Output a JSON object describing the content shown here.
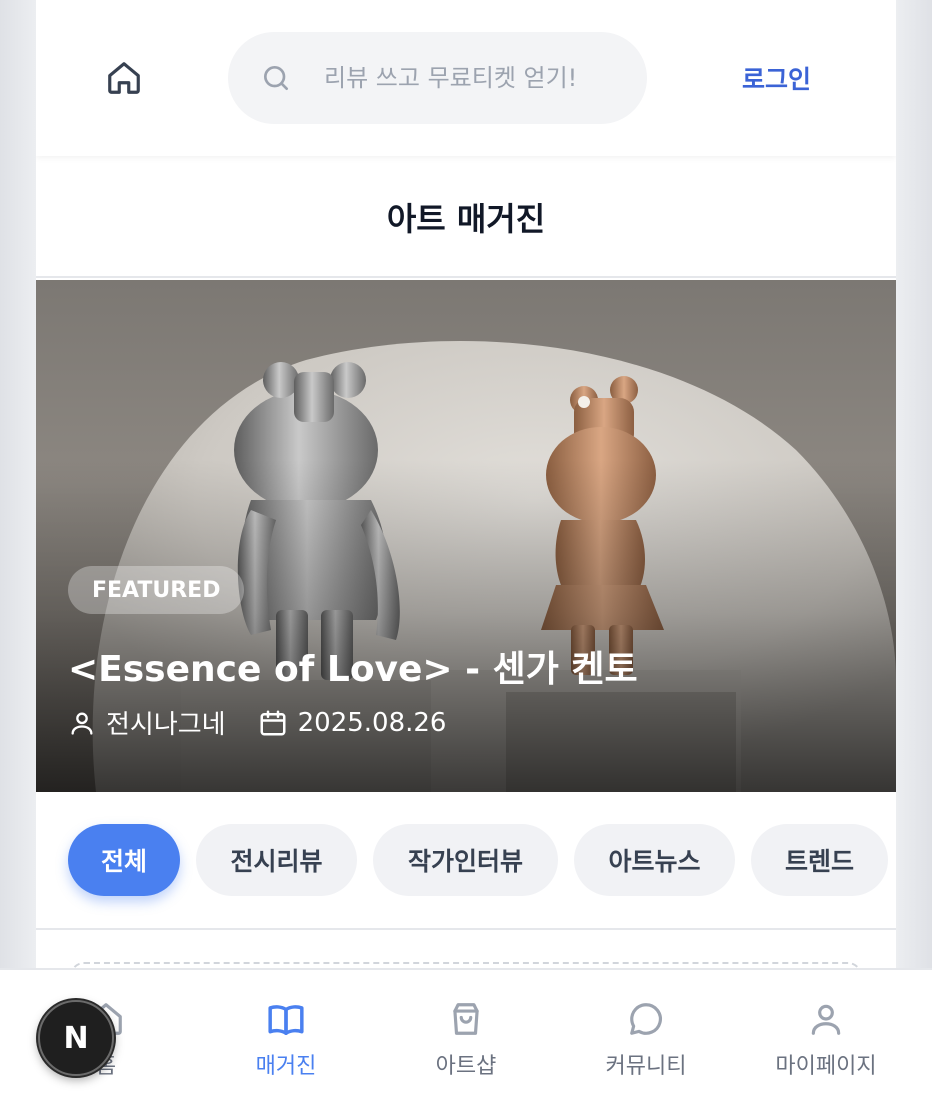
{
  "header": {
    "home_icon": "home-icon",
    "search_placeholder": "리뷰 쓰고 무료티켓 얻기!",
    "search_icon": "search-icon",
    "login_label": "로그인"
  },
  "page_title": "아트 매거진",
  "featured": {
    "badge": "FEATURED",
    "title": "<Essence of Love> - 센가 켄토",
    "author": "전시나그네",
    "date": "2025.08.26",
    "author_icon": "user-icon",
    "date_icon": "calendar-icon"
  },
  "categories": [
    {
      "label": "전체",
      "active": true
    },
    {
      "label": "전시리뷰",
      "active": false
    },
    {
      "label": "작가인터뷰",
      "active": false
    },
    {
      "label": "아트뉴스",
      "active": false
    },
    {
      "label": "트렌드",
      "active": false
    }
  ],
  "bottom_nav": [
    {
      "label": "홈",
      "icon": "home-icon",
      "active": false
    },
    {
      "label": "매거진",
      "icon": "book-open-icon",
      "active": true
    },
    {
      "label": "아트샵",
      "icon": "shopping-bag-icon",
      "active": false
    },
    {
      "label": "커뮤니티",
      "icon": "chat-bubble-icon",
      "active": false
    },
    {
      "label": "마이페이지",
      "icon": "user-icon",
      "active": false
    }
  ],
  "dev_badge": "N",
  "colors": {
    "accent": "#4a80f0",
    "login": "#3b63d6",
    "chip_bg": "#f1f2f5"
  }
}
